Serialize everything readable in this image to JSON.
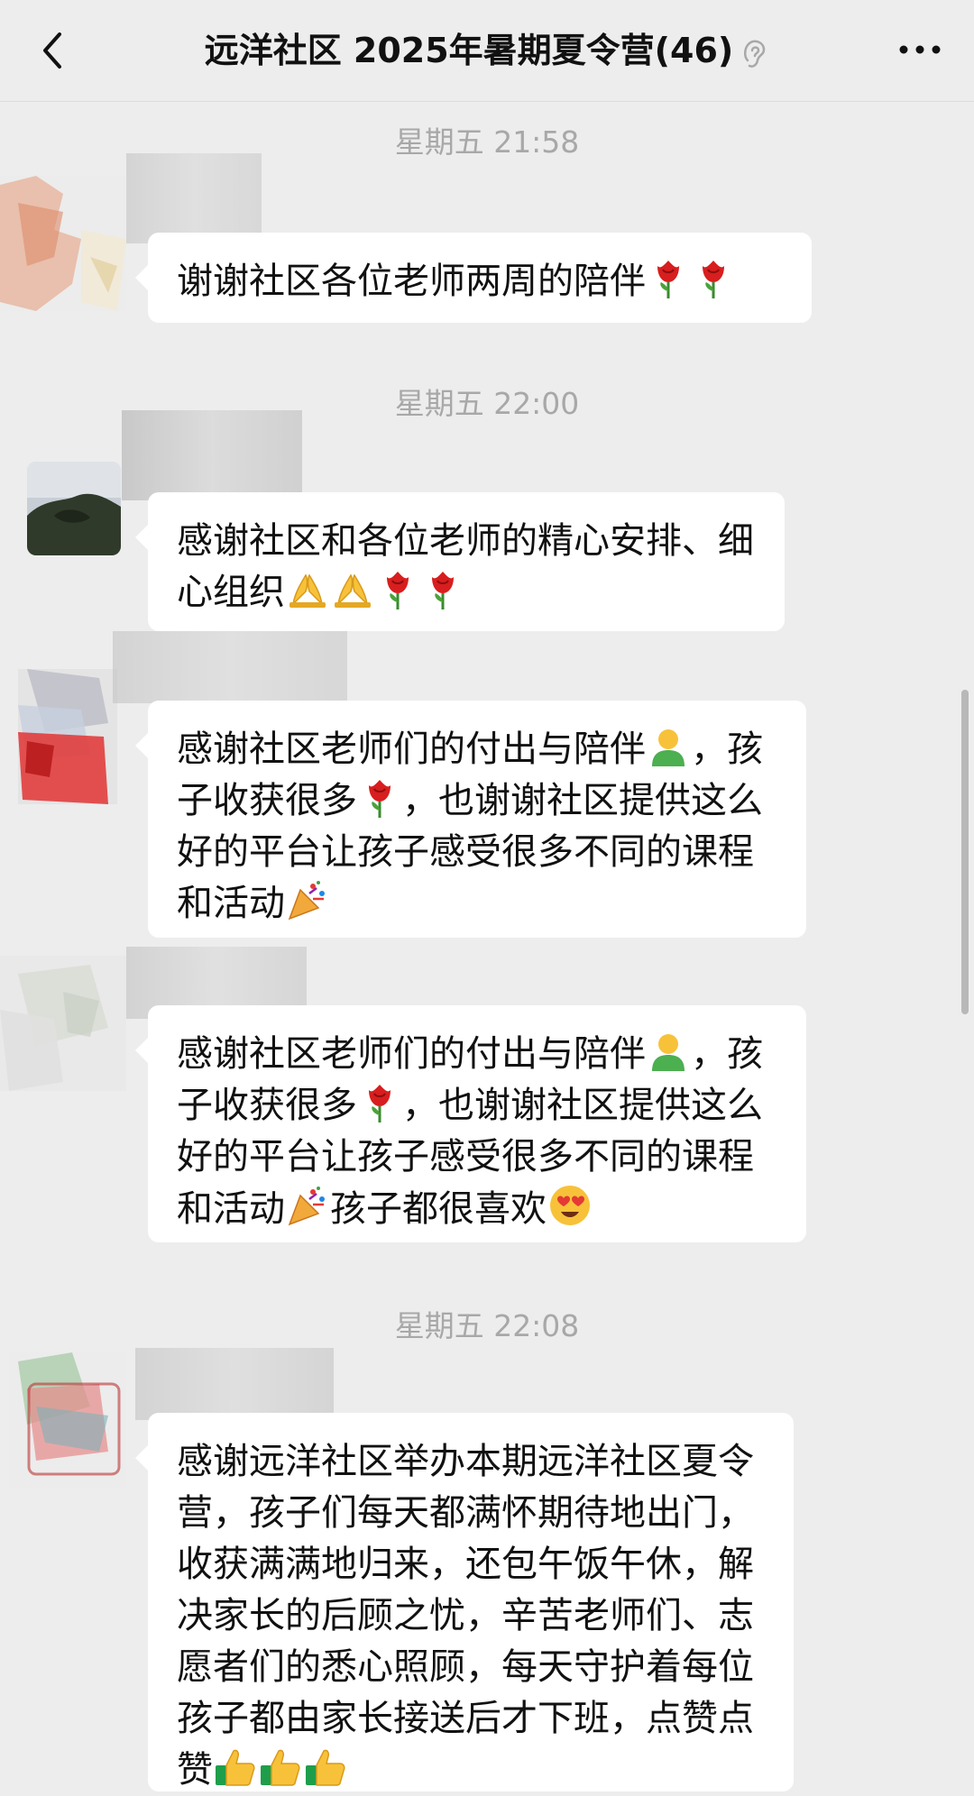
{
  "header": {
    "title": "远洋社区 2025年暑期夏令营(46)"
  },
  "messages": [
    {
      "timestamp": "星期五 21:58",
      "text": "谢谢社区各位老师两周的陪伴",
      "emojis": [
        "rose",
        "rose"
      ]
    },
    {
      "timestamp": "星期五 22:00",
      "text": "感谢社区和各位老师的精心安排、细心组织",
      "emojis": [
        "folded-hands",
        "folded-hands",
        "rose",
        "rose"
      ]
    },
    {
      "text_parts": [
        "感谢社区老师们的付出与陪伴",
        "，孩子收获很多",
        "，也谢谢社区提供这么好的平台让孩子感受很多不同的课程和活动"
      ],
      "emojis": [
        "person",
        "rose",
        "party-popper"
      ]
    },
    {
      "text_parts": [
        "感谢社区老师们的付出与陪伴",
        "，孩子收获很多",
        "，也谢谢社区提供这么好的平台让孩子感受很多不同的课程和活动",
        "孩子都很喜欢"
      ],
      "emojis": [
        "person",
        "rose",
        "party-popper",
        "heart-eyes"
      ]
    },
    {
      "timestamp": "星期五 22:08",
      "text": "感谢远洋社区举办本期远洋社区夏令营，孩子们每天都满怀期待地出门，收获满满地归来，还包午饭午休，解决家长的后顾之忧，辛苦老师们、志愿者们的悉心照顾，每天守护着每位孩子都由家长接送后才下班，点赞点赞",
      "emojis": [
        "thumbs-up",
        "thumbs-up",
        "thumbs-up"
      ]
    }
  ],
  "colors": {
    "background": "#ededed",
    "bubble": "#ffffff",
    "timestamp": "#a8a8a8"
  }
}
